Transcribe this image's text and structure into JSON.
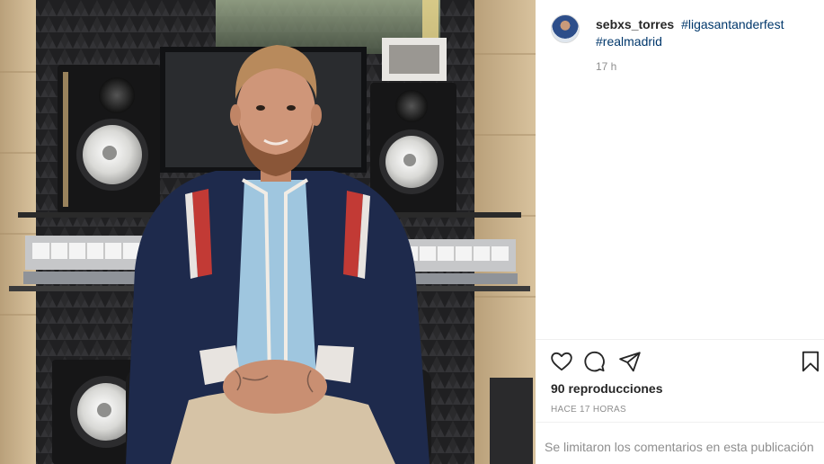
{
  "post": {
    "username": "sebxs_torres",
    "hashtags": [
      "#ligasantanderfest",
      "#realmadrid"
    ],
    "time_ago": "17 h",
    "views": "90 reproducciones",
    "posted_label": "HACE 17 HORAS",
    "comments_disabled": "Se limitaron los comentarios en esta publicación"
  },
  "icons": {
    "like": "heart-outline-icon",
    "comment": "speech-bubble-icon",
    "share": "paper-plane-icon",
    "save": "bookmark-icon"
  },
  "colors": {
    "text": "#262626",
    "hashtag": "#00376b",
    "muted": "#8e8e8e",
    "divider": "#efefef"
  }
}
